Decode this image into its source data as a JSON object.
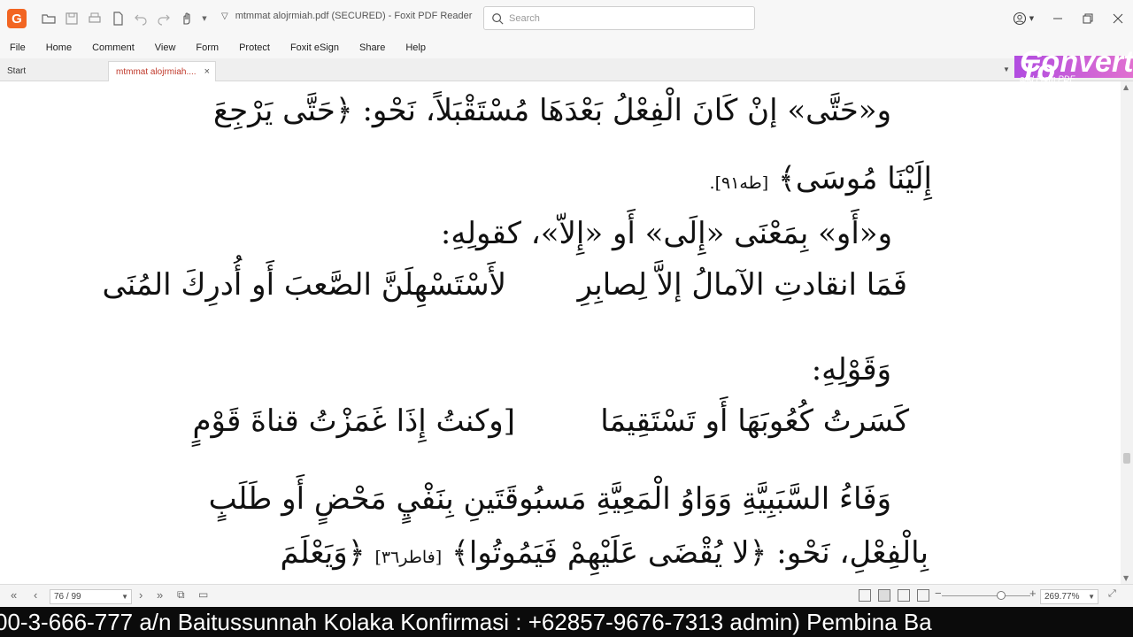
{
  "app": {
    "title": "mtmmat alojrmiah.pdf (SECURED) - Foxit PDF Reader",
    "logo_letter": "G"
  },
  "search": {
    "placeholder": "Search"
  },
  "menu": [
    "File",
    "Home",
    "Comment",
    "View",
    "Form",
    "Protect",
    "Foxit eSign",
    "Share",
    "Help"
  ],
  "tabs": {
    "start": "Start",
    "active": "mtmmat alojrmiah....",
    "close": "×"
  },
  "convert": {
    "line1": "Convert To",
    "line2": "and From PDF"
  },
  "document": {
    "line1": "و«حَتَّى» إنْ كَانَ الْفِعْلُ بَعْدَهَا مُسْتَقْبَلاً، نَحْو: ﴿حَتَّى يَرْجِعَ",
    "line2": "إِلَيْنَا مُوسَى﴾",
    "line2_ref": "[طه٩١].",
    "line3": "و«أَو» بِمَعْنَى «إِلَى» أَو «إِلاّ»، كقولِهِ:",
    "verse1_right": "لأَسْتَسْهِلَنَّ الصَّعبَ أَو أُدرِكَ المُنَى",
    "verse1_left": "فَمَا انقادتِ الآمالُ إلاَّ لِصابِرِ",
    "line5": "وَقَوْلِهِ:",
    "verse2_right": "[وكنتُ إِذَا غَمَزْتُ قناةَ قَوْمٍ",
    "verse2_left": "كَسَرتُ كُعُوبَهَا أَو تَسْتَقِيمَا",
    "line7": "وَفَاءُ السَّبَبِيَّةِ وَوَاوُ الْمَعِيَّةِ مَسبُوقَتَينِ بِنَفْيٍ مَحْضٍ أَو طَلَبٍ",
    "line8": "بِالْفِعْلِ، نَحْو: ﴿لا يُقْضَى عَلَيْهِمْ فَيَمُوتُوا﴾",
    "line8_ref": "[فاطر٣٦]",
    "line8_end": "﴿وَيَعْلَمَ"
  },
  "statusbar": {
    "page": "76 / 99",
    "zoom": "269.77%"
  },
  "ticker": {
    "text": "00-3-666-777 a/n Baitussunnah Kolaka Konfirmasi : +62857-9676-7313 admin) Pembina Ba"
  },
  "colors": {
    "accent": "#c0392b",
    "logo": "#f26522",
    "convert_start": "#b14ce0",
    "convert_end": "#e070d0"
  },
  "icons": [
    "open-folder-icon",
    "save-icon",
    "print-icon",
    "new-doc-icon",
    "undo-icon",
    "redo-icon",
    "hand-icon",
    "search-icon",
    "account-icon",
    "minimize-icon",
    "restore-icon",
    "close-icon"
  ]
}
